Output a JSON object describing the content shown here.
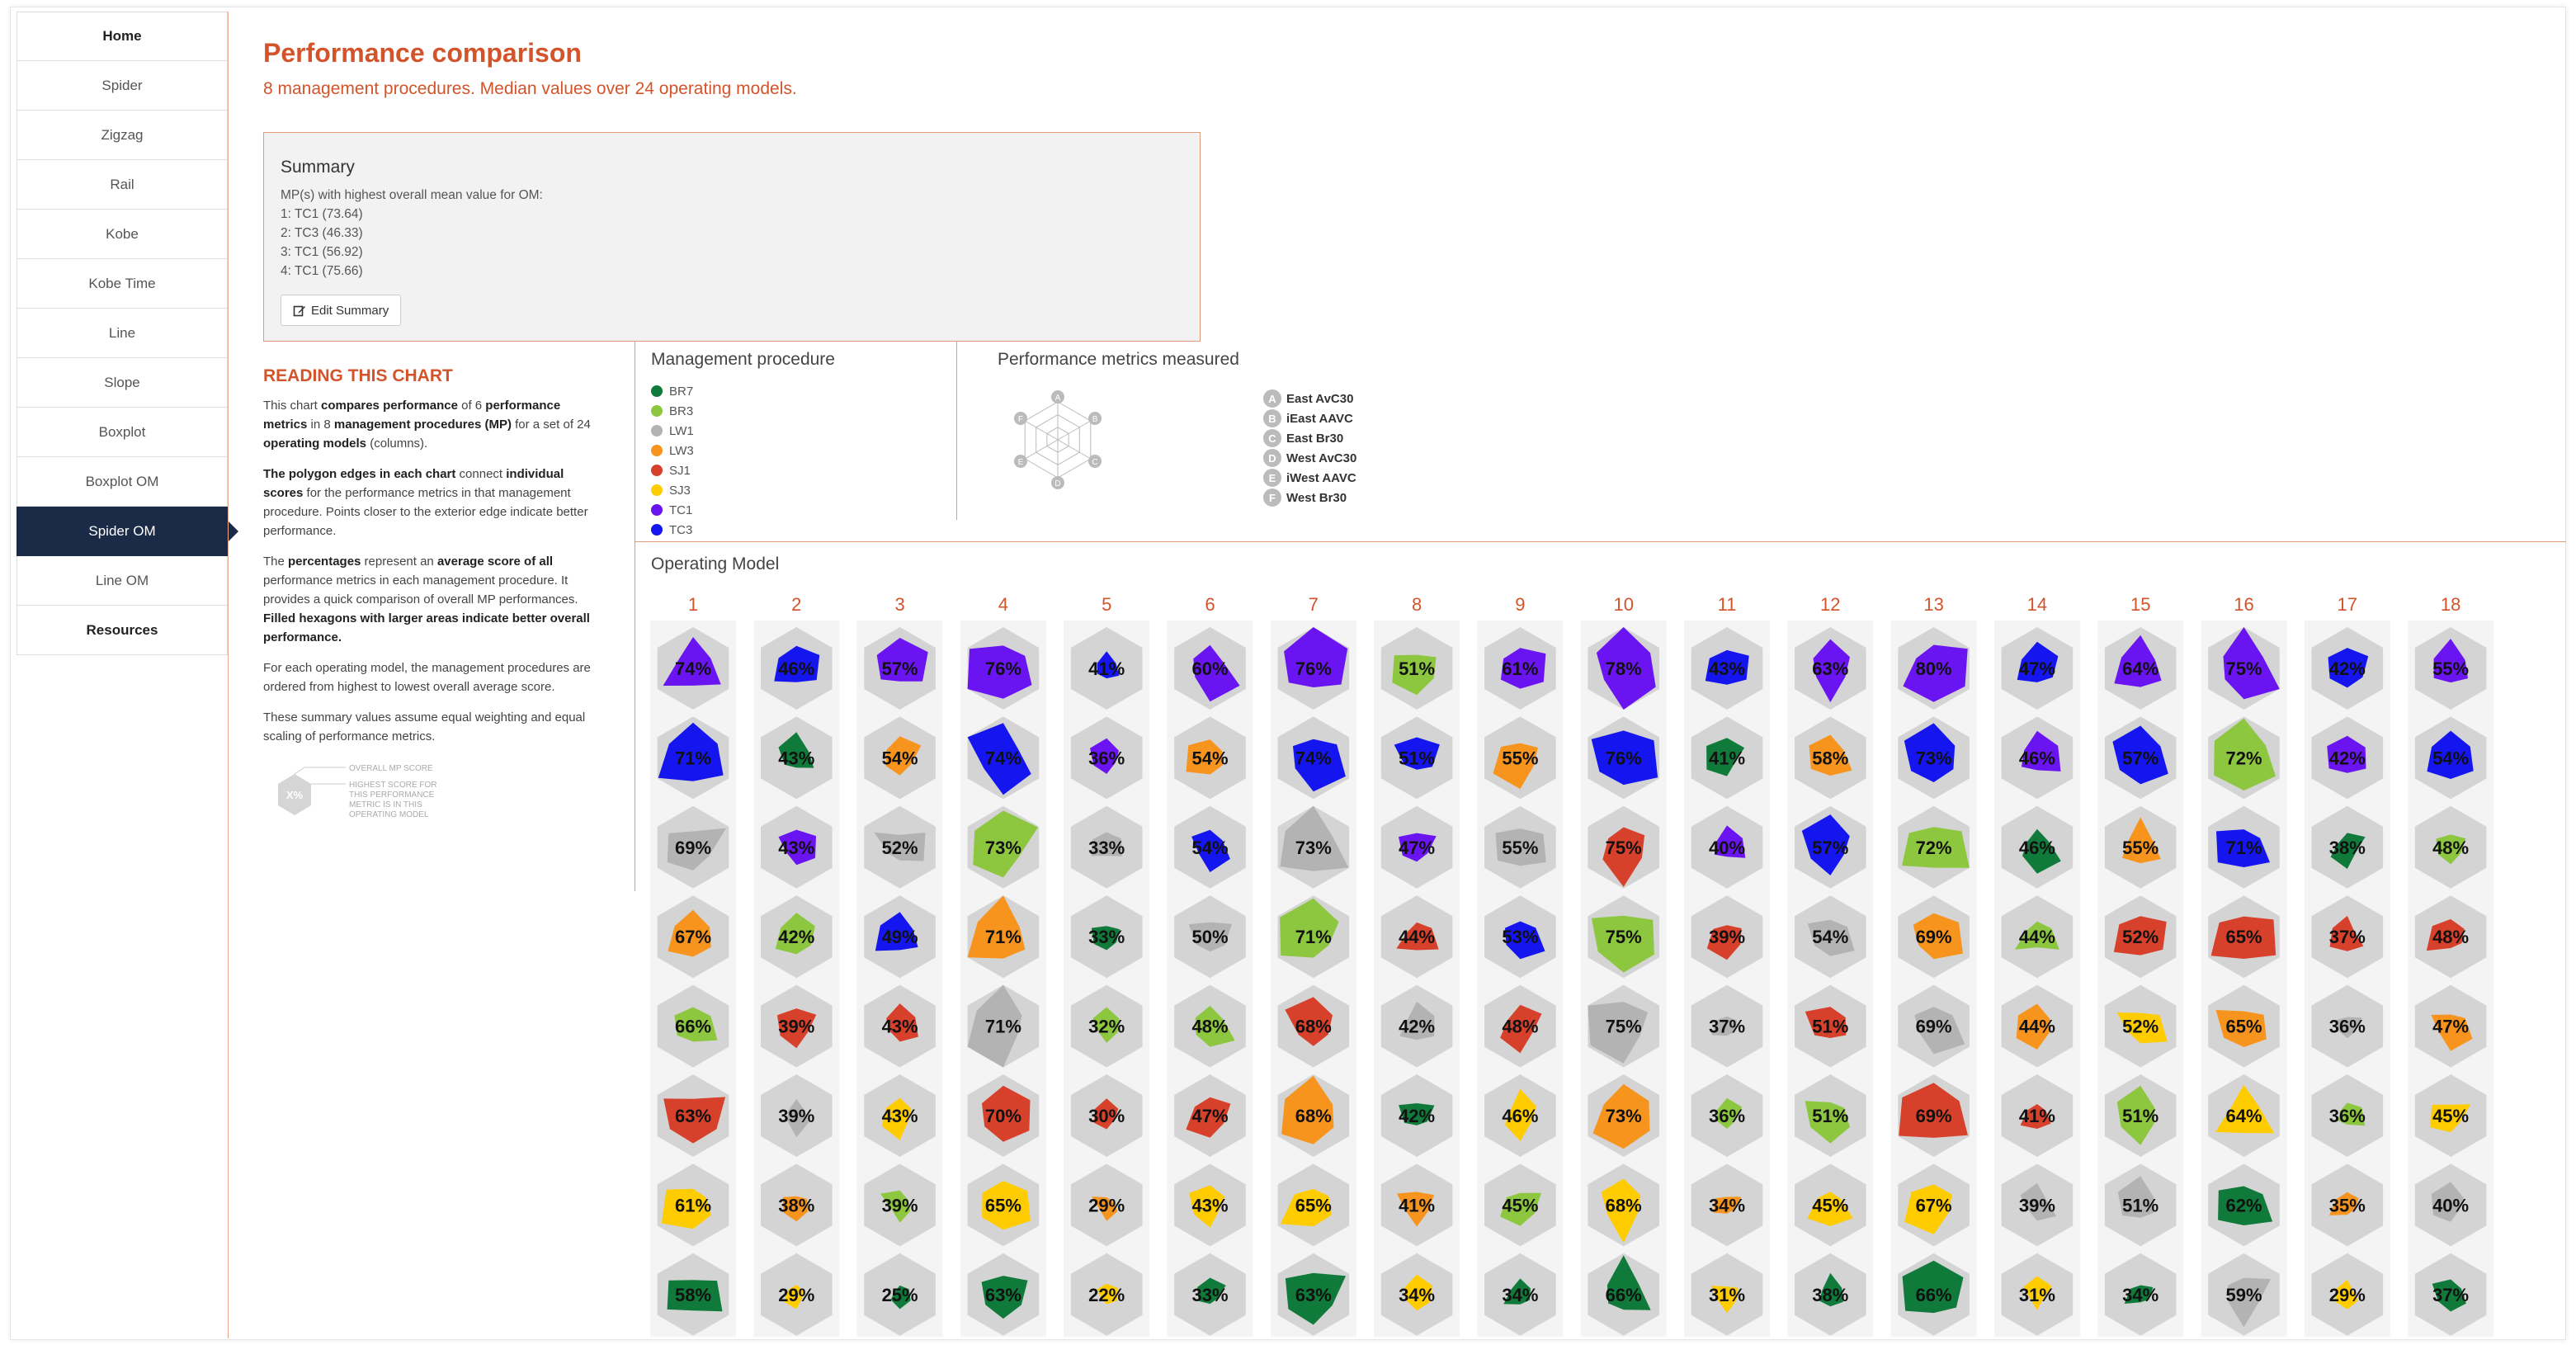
{
  "nav": {
    "items": [
      {
        "label": "Home",
        "bold": true,
        "active": false
      },
      {
        "label": "Spider",
        "bold": false,
        "active": false
      },
      {
        "label": "Zigzag",
        "bold": false,
        "active": false
      },
      {
        "label": "Rail",
        "bold": false,
        "active": false
      },
      {
        "label": "Kobe",
        "bold": false,
        "active": false
      },
      {
        "label": "Kobe Time",
        "bold": false,
        "active": false
      },
      {
        "label": "Line",
        "bold": false,
        "active": false
      },
      {
        "label": "Slope",
        "bold": false,
        "active": false
      },
      {
        "label": "Boxplot",
        "bold": false,
        "active": false
      },
      {
        "label": "Boxplot OM",
        "bold": false,
        "active": false
      },
      {
        "label": "Spider OM",
        "bold": false,
        "active": true
      },
      {
        "label": "Line OM",
        "bold": false,
        "active": false
      },
      {
        "label": "Resources",
        "bold": true,
        "active": false
      }
    ]
  },
  "header": {
    "title": "Performance comparison",
    "subtitle": "8 management procedures. Median values over 24 operating models."
  },
  "summary": {
    "title": "Summary",
    "lines": [
      "MP(s) with highest overall mean value for OM:",
      "1: TC1 (73.64)",
      "2: TC3 (46.33)",
      "3: TC1 (56.92)",
      "4: TC1 (75.66)"
    ],
    "edit_label": "Edit Summary"
  },
  "reading": {
    "heading": "READING THIS CHART",
    "p1": [
      {
        "t": "This chart ",
        "b": false
      },
      {
        "t": "compares performance",
        "b": true
      },
      {
        "t": " of 6 ",
        "b": false
      },
      {
        "t": "performance metrics",
        "b": true
      },
      {
        "t": " in 8 ",
        "b": false
      },
      {
        "t": "management procedures (MP)",
        "b": true
      },
      {
        "t": " for a set of 24 ",
        "b": false
      },
      {
        "t": "operating models",
        "b": true
      },
      {
        "t": " (columns).",
        "b": false
      }
    ],
    "p2": [
      {
        "t": "The polygon edges in each chart",
        "b": true
      },
      {
        "t": " connect ",
        "b": false
      },
      {
        "t": "individual scores",
        "b": true
      },
      {
        "t": " for the performance metrics in that management procedure. Points closer to the exterior edge indicate better performance.",
        "b": false
      }
    ],
    "p3": [
      {
        "t": "The ",
        "b": false
      },
      {
        "t": "percentages",
        "b": true
      },
      {
        "t": " represent an ",
        "b": false
      },
      {
        "t": "average score of all",
        "b": true
      },
      {
        "t": " performance metrics in each management procedure. It provides a quick comparison of overall MP performances. ",
        "b": false
      },
      {
        "t": "Filled hexagons with larger areas indicate better overall performance.",
        "b": true
      }
    ],
    "p4": "For each operating model, the management procedures are ordered from highest to lowest overall average score.",
    "p5": "These summary values assume equal weighting and equal scaling of performance metrics.",
    "key_lines": [
      "OVERALL MP SCORE",
      "HIGHEST SCORE FOR",
      "THIS PERFORMANCE",
      "METRIC IS IN THIS",
      "OPERATING MODEL"
    ],
    "key_badge": "X%"
  },
  "legend_mp": {
    "title": "Management procedure",
    "items": [
      {
        "name": "BR7",
        "color": "#0f7a3a"
      },
      {
        "name": "BR3",
        "color": "#8dc63f"
      },
      {
        "name": "LW1",
        "color": "#b3b3b3"
      },
      {
        "name": "LW3",
        "color": "#f7941d"
      },
      {
        "name": "SJ1",
        "color": "#d7402b"
      },
      {
        "name": "SJ3",
        "color": "#ffcc00"
      },
      {
        "name": "TC1",
        "color": "#6a14f2"
      },
      {
        "name": "TC3",
        "color": "#1515f0"
      }
    ]
  },
  "legend_pm": {
    "title": "Performance metrics measured",
    "items": [
      {
        "letter": "A",
        "name": "East AvC30"
      },
      {
        "letter": "B",
        "name": "iEast AAVC"
      },
      {
        "letter": "C",
        "name": "East Br30"
      },
      {
        "letter": "D",
        "name": "West AvC30"
      },
      {
        "letter": "E",
        "name": "iWest AAVC"
      },
      {
        "letter": "F",
        "name": "West Br30"
      }
    ]
  },
  "chart_data": {
    "type": "radar",
    "title": "Operating Model",
    "metrics": [
      "A",
      "B",
      "C",
      "D",
      "E",
      "F"
    ],
    "columns": [
      {
        "om": "1",
        "rows": [
          [
            "TC1",
            74
          ],
          [
            "TC3",
            71
          ],
          [
            "LW1",
            69
          ],
          [
            "LW3",
            67
          ],
          [
            "BR3",
            66
          ],
          [
            "SJ1",
            63
          ],
          [
            "SJ3",
            61
          ],
          [
            "BR7",
            58
          ]
        ]
      },
      {
        "om": "2",
        "rows": [
          [
            "TC3",
            46
          ],
          [
            "BR7",
            43
          ],
          [
            "TC1",
            43
          ],
          [
            "BR3",
            42
          ],
          [
            "SJ1",
            39
          ],
          [
            "LW1",
            39
          ],
          [
            "LW3",
            38
          ],
          [
            "SJ3",
            29
          ]
        ]
      },
      {
        "om": "3",
        "rows": [
          [
            "TC1",
            57
          ],
          [
            "LW3",
            54
          ],
          [
            "LW1",
            52
          ],
          [
            "TC3",
            49
          ],
          [
            "SJ1",
            43
          ],
          [
            "SJ3",
            43
          ],
          [
            "BR3",
            39
          ],
          [
            "BR7",
            25
          ]
        ]
      },
      {
        "om": "4",
        "rows": [
          [
            "TC1",
            76
          ],
          [
            "TC3",
            74
          ],
          [
            "BR3",
            73
          ],
          [
            "LW3",
            71
          ],
          [
            "LW1",
            71
          ],
          [
            "SJ1",
            70
          ],
          [
            "SJ3",
            65
          ],
          [
            "BR7",
            63
          ]
        ]
      },
      {
        "om": "5",
        "rows": [
          [
            "TC3",
            41
          ],
          [
            "TC1",
            36
          ],
          [
            "LW1",
            33
          ],
          [
            "BR7",
            33
          ],
          [
            "BR3",
            32
          ],
          [
            "SJ1",
            30
          ],
          [
            "LW3",
            29
          ],
          [
            "SJ3",
            22
          ]
        ]
      },
      {
        "om": "6",
        "rows": [
          [
            "TC1",
            60
          ],
          [
            "LW3",
            54
          ],
          [
            "TC3",
            54
          ],
          [
            "LW1",
            50
          ],
          [
            "BR3",
            48
          ],
          [
            "SJ1",
            47
          ],
          [
            "SJ3",
            43
          ],
          [
            "BR7",
            33
          ]
        ]
      },
      {
        "om": "7",
        "rows": [
          [
            "TC1",
            76
          ],
          [
            "TC3",
            74
          ],
          [
            "LW1",
            73
          ],
          [
            "BR3",
            71
          ],
          [
            "SJ1",
            68
          ],
          [
            "LW3",
            68
          ],
          [
            "SJ3",
            65
          ],
          [
            "BR7",
            63
          ]
        ]
      },
      {
        "om": "8",
        "rows": [
          [
            "BR3",
            51
          ],
          [
            "TC3",
            51
          ],
          [
            "TC1",
            47
          ],
          [
            "SJ1",
            44
          ],
          [
            "LW1",
            42
          ],
          [
            "BR7",
            42
          ],
          [
            "LW3",
            41
          ],
          [
            "SJ3",
            34
          ]
        ]
      },
      {
        "om": "9",
        "rows": [
          [
            "TC1",
            61
          ],
          [
            "LW3",
            55
          ],
          [
            "LW1",
            55
          ],
          [
            "TC3",
            53
          ],
          [
            "SJ1",
            48
          ],
          [
            "SJ3",
            46
          ],
          [
            "BR3",
            45
          ],
          [
            "BR7",
            34
          ]
        ]
      },
      {
        "om": "10",
        "rows": [
          [
            "TC1",
            78
          ],
          [
            "TC3",
            76
          ],
          [
            "SJ1",
            75
          ],
          [
            "BR3",
            75
          ],
          [
            "LW1",
            75
          ],
          [
            "LW3",
            73
          ],
          [
            "SJ3",
            68
          ],
          [
            "BR7",
            66
          ]
        ]
      },
      {
        "om": "11",
        "rows": [
          [
            "TC3",
            43
          ],
          [
            "BR7",
            41
          ],
          [
            "TC1",
            40
          ],
          [
            "SJ1",
            39
          ],
          [
            "LW1",
            37
          ],
          [
            "BR3",
            36
          ],
          [
            "LW3",
            34
          ],
          [
            "SJ3",
            31
          ]
        ]
      },
      {
        "om": "12",
        "rows": [
          [
            "TC1",
            63
          ],
          [
            "LW3",
            58
          ],
          [
            "TC3",
            57
          ],
          [
            "LW1",
            54
          ],
          [
            "SJ1",
            51
          ],
          [
            "BR3",
            51
          ],
          [
            "SJ3",
            45
          ],
          [
            "BR7",
            38
          ]
        ]
      },
      {
        "om": "13",
        "rows": [
          [
            "TC1",
            80
          ],
          [
            "TC3",
            73
          ],
          [
            "BR3",
            72
          ],
          [
            "LW3",
            69
          ],
          [
            "LW1",
            69
          ],
          [
            "SJ1",
            69
          ],
          [
            "SJ3",
            67
          ],
          [
            "BR7",
            66
          ]
        ]
      },
      {
        "om": "14",
        "rows": [
          [
            "TC3",
            47
          ],
          [
            "TC1",
            46
          ],
          [
            "BR7",
            46
          ],
          [
            "BR3",
            44
          ],
          [
            "LW3",
            44
          ],
          [
            "SJ1",
            41
          ],
          [
            "LW1",
            39
          ],
          [
            "SJ3",
            31
          ]
        ]
      },
      {
        "om": "15",
        "rows": [
          [
            "TC1",
            64
          ],
          [
            "TC3",
            57
          ],
          [
            "LW3",
            55
          ],
          [
            "SJ1",
            52
          ],
          [
            "SJ3",
            52
          ],
          [
            "BR3",
            51
          ],
          [
            "LW1",
            51
          ],
          [
            "BR7",
            34
          ]
        ]
      },
      {
        "om": "16",
        "rows": [
          [
            "TC1",
            75
          ],
          [
            "BR3",
            72
          ],
          [
            "TC3",
            71
          ],
          [
            "SJ1",
            65
          ],
          [
            "LW3",
            65
          ],
          [
            "SJ3",
            64
          ],
          [
            "BR7",
            62
          ],
          [
            "LW1",
            59
          ]
        ]
      },
      {
        "om": "17",
        "rows": [
          [
            "TC3",
            42
          ],
          [
            "TC1",
            42
          ],
          [
            "BR7",
            38
          ],
          [
            "SJ1",
            37
          ],
          [
            "LW1",
            36
          ],
          [
            "BR3",
            36
          ],
          [
            "LW3",
            35
          ],
          [
            "SJ3",
            29
          ]
        ]
      },
      {
        "om": "18",
        "rows": [
          [
            "TC1",
            55
          ],
          [
            "TC3",
            54
          ],
          [
            "BR3",
            48
          ],
          [
            "SJ1",
            48
          ],
          [
            "LW3",
            47
          ],
          [
            "SJ3",
            45
          ],
          [
            "LW1",
            40
          ],
          [
            "BR7",
            37
          ]
        ]
      }
    ]
  }
}
